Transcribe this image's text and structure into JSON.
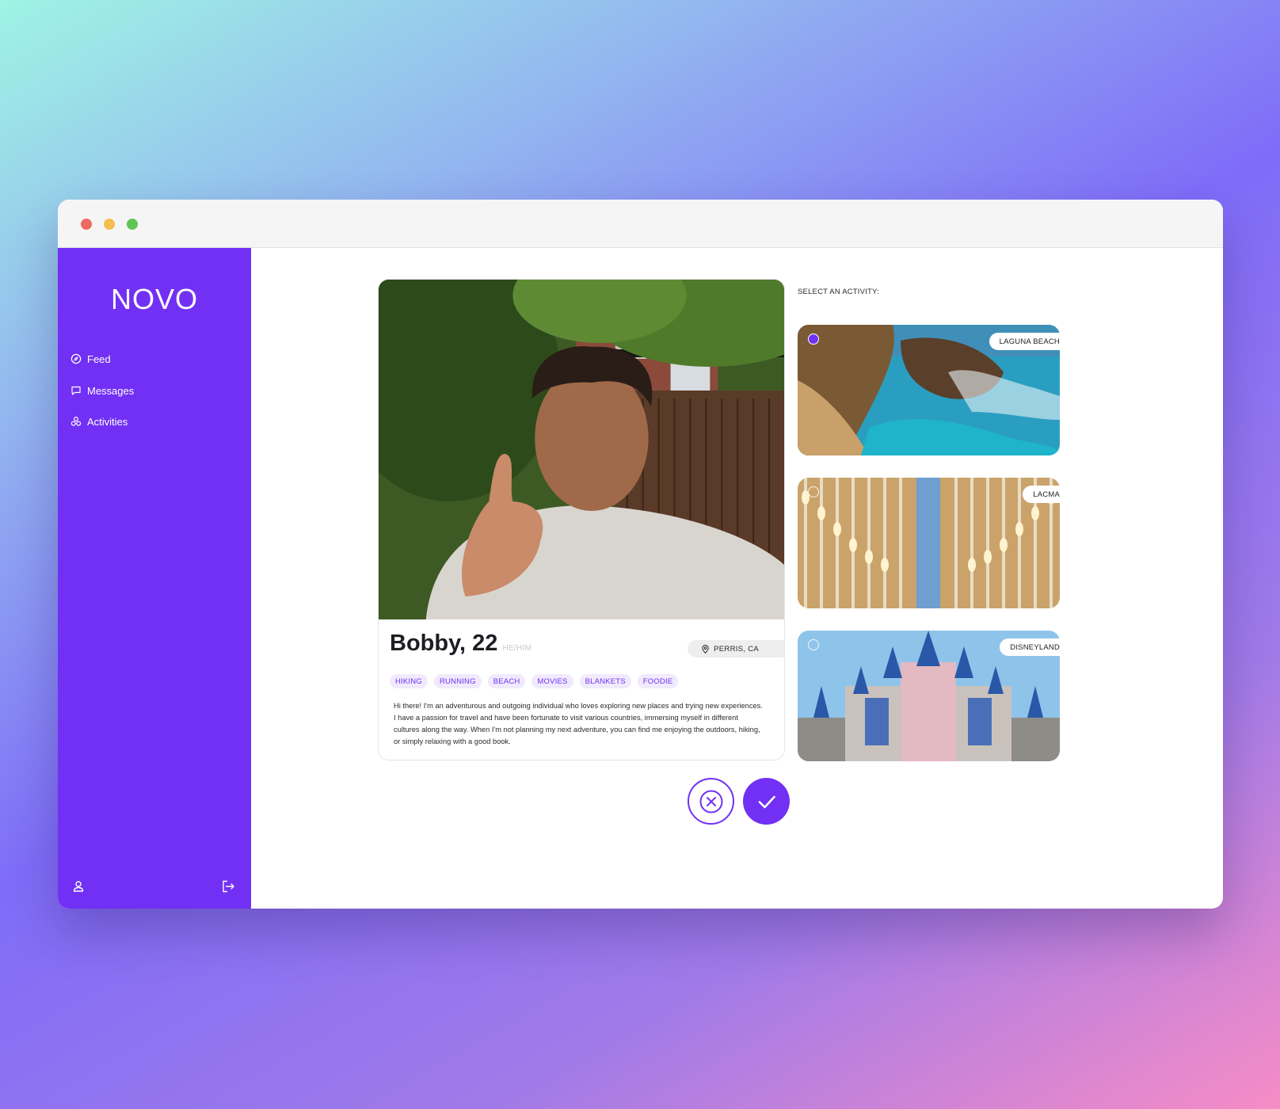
{
  "app": {
    "logo": "NOVO"
  },
  "sidebar": {
    "items": [
      {
        "label": "Feed",
        "icon": "compass-icon"
      },
      {
        "label": "Messages",
        "icon": "chat-icon"
      },
      {
        "label": "Activities",
        "icon": "people-icon"
      }
    ],
    "bottom_icons": [
      "user-icon",
      "logout-icon"
    ]
  },
  "profile": {
    "name": "Bobby, 22",
    "pronouns": "HE/HIM",
    "location": "PERRIS, CA",
    "tags": [
      "HIKING",
      "RUNNING",
      "BEACH",
      "MOVIES",
      "BLANKETS",
      "FOODIE"
    ],
    "bio": "Hi there! I'm an adventurous and outgoing individual who loves exploring new places and trying new experiences. I have a passion for travel and have been fortunate to visit various countries, immersing myself in different cultures along the way. When I'm not planning my next adventure, you can find me enjoying the outdoors, hiking, or simply relaxing with a good book."
  },
  "activities": {
    "label": "SELECT AN ACTIVITY:",
    "items": [
      {
        "name": "LAGUNA BEACH",
        "selected": true
      },
      {
        "name": "LACMA",
        "selected": false
      },
      {
        "name": "DISNEYLAND",
        "selected": false
      }
    ]
  },
  "actions": {
    "reject_icon": "close-icon",
    "accept_icon": "check-icon"
  },
  "colors": {
    "accent": "#7130f4",
    "tag_bg": "#f0eafc"
  }
}
